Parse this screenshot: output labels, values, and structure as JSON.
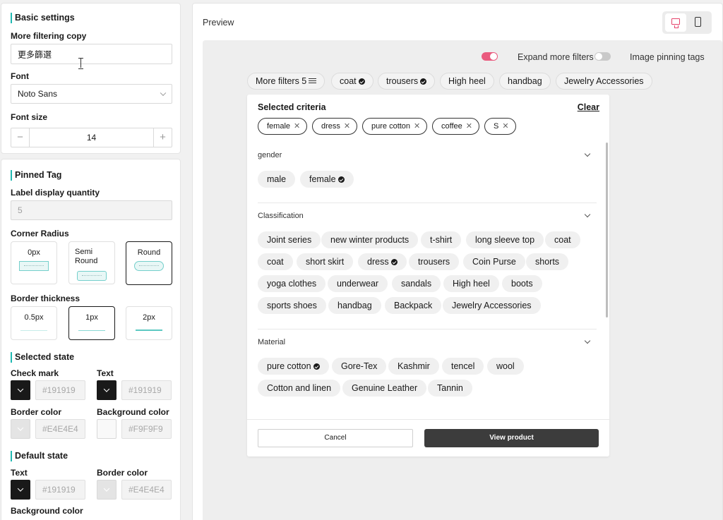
{
  "basic_settings": {
    "title": "Basic settings",
    "filter_copy_label": "More filtering copy",
    "filter_copy_value": "更多篩選",
    "font_label": "Font",
    "font_value": "Noto Sans",
    "font_size_label": "Font size",
    "font_size_value": "14",
    "minus": "−",
    "plus": "+"
  },
  "pinned_tag": {
    "title": "Pinned Tag",
    "label_qty_label": "Label display quantity",
    "label_qty_value": "5",
    "corner_radius_label": "Corner Radius",
    "corner_options": [
      "0px",
      "Semi Round",
      "Round"
    ],
    "corner_selected": "Round",
    "border_thickness_label": "Border thickness",
    "border_options": [
      "0.5px",
      "1px",
      "2px"
    ],
    "border_selected": "1px",
    "selected_state_title": "Selected state",
    "check_mark_label": "Check mark",
    "check_mark_color": "#191919",
    "text_label": "Text",
    "text_color": "#191919",
    "border_color_label": "Border color",
    "border_color": "#E4E4E4",
    "background_color_label": "Background color",
    "background_color": "#F9F9F9",
    "default_state_title": "Default state",
    "default_text_label": "Text",
    "default_text_color": "#191919",
    "default_border_label": "Border color",
    "default_border_color": "#E4E4E4",
    "default_bg_label": "Background color"
  },
  "preview": {
    "title": "Preview",
    "toggle_expand_label": "Expand more filters",
    "toggle_expand_on": true,
    "toggle_pinning_label": "Image pinning tags",
    "toggle_pinning_on": false,
    "more_filters": "More filters 5",
    "top_tags": [
      {
        "label": "coat",
        "checked": true
      },
      {
        "label": "trousers",
        "checked": true
      },
      {
        "label": "High heel",
        "checked": false
      },
      {
        "label": "handbag",
        "checked": false
      },
      {
        "label": "Jewelry Accessories",
        "checked": false
      }
    ],
    "panel": {
      "selected_title": "Selected criteria",
      "clear": "Clear",
      "selected": [
        "female",
        "dress",
        "pure cotton",
        "coffee",
        "S"
      ],
      "groups": {
        "gender": {
          "title": "gender",
          "tags": [
            {
              "label": "male"
            },
            {
              "label": "female",
              "checked": true
            }
          ]
        },
        "classification": {
          "title": "Classification",
          "tags": [
            {
              "label": "Joint series"
            },
            {
              "label": "new winter products"
            },
            {
              "label": "t-shirt"
            },
            {
              "label": "long sleeve top"
            },
            {
              "label": "coat"
            },
            {
              "label": "coat"
            },
            {
              "label": "short skirt"
            },
            {
              "label": "dress",
              "checked": true
            },
            {
              "label": "trousers"
            },
            {
              "label": "Coin Purse"
            },
            {
              "label": "shorts"
            },
            {
              "label": "yoga clothes"
            },
            {
              "label": "underwear"
            },
            {
              "label": "sandals"
            },
            {
              "label": "High heel"
            },
            {
              "label": "boots"
            },
            {
              "label": "sports shoes"
            },
            {
              "label": "handbag"
            },
            {
              "label": "Backpack"
            },
            {
              "label": "Jewelry Accessories"
            }
          ]
        },
        "material": {
          "title": "Material",
          "tags": [
            {
              "label": "pure cotton",
              "checked": true
            },
            {
              "label": "Gore-Tex"
            },
            {
              "label": "Kashmir"
            },
            {
              "label": "tencel"
            },
            {
              "label": "wool"
            },
            {
              "label": "Cotton and linen"
            },
            {
              "label": "Genuine Leather"
            },
            {
              "label": "Tannin"
            }
          ]
        }
      },
      "cancel": "Cancel",
      "view_product": "View product"
    }
  },
  "colors": {
    "accent": "#21B9B2",
    "toggle_on": "#EA5A7E",
    "device_active": "#E5436B",
    "primary_button": "#3C3C3C"
  },
  "icons": [
    "desktop-icon",
    "mobile-icon",
    "filter-icon",
    "check-icon",
    "close-icon",
    "chevron-down-icon"
  ]
}
